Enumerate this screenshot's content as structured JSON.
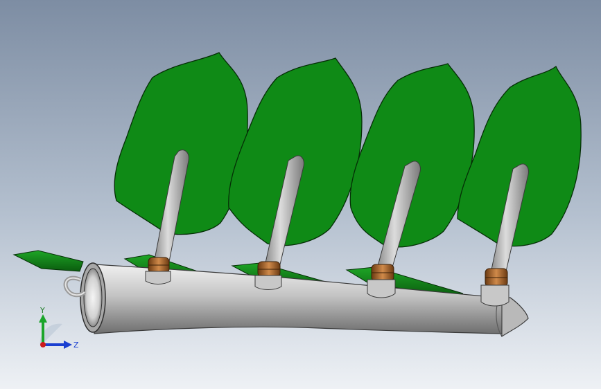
{
  "viewport": {
    "background_top": "#7f8ea3",
    "background_bottom": "#e8ecf2"
  },
  "model": {
    "leaf_color": "#0f8a16",
    "leaf_outline": "#052e06",
    "pipe_color": "#c9c9c9",
    "ring_color": "#b06a2a",
    "blade_count": 4
  },
  "triad": {
    "y_label": "Y",
    "z_label": "Z",
    "y_color": "#1aa52a",
    "z_color": "#1a3fd0",
    "x_color": "#cc1a1a"
  }
}
